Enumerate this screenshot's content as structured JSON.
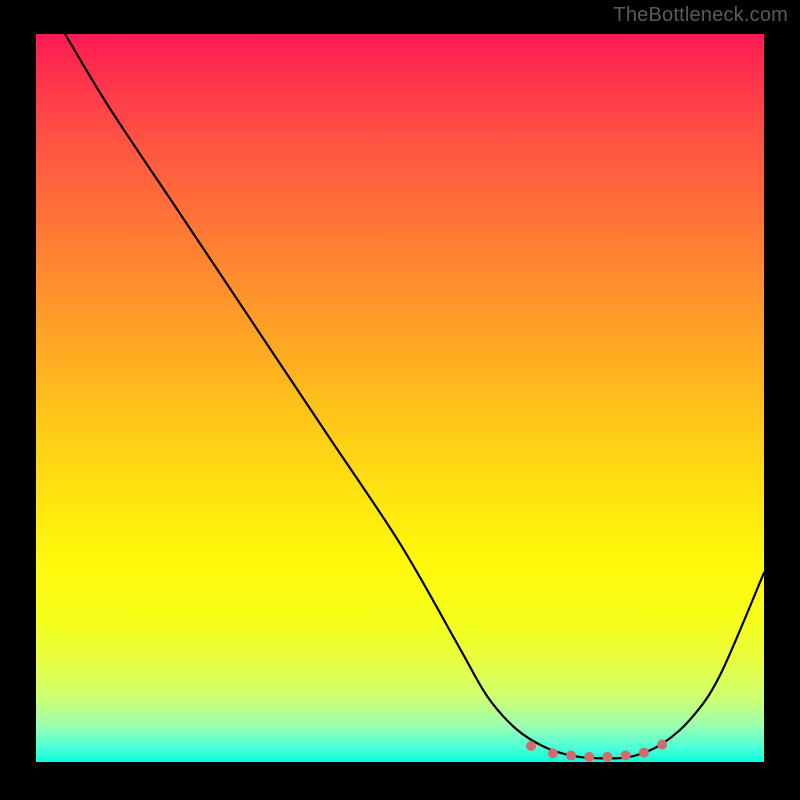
{
  "attribution": "TheBottleneck.com",
  "chart_data": {
    "type": "line",
    "title": "",
    "xlabel": "",
    "ylabel": "",
    "xlim": [
      0,
      100
    ],
    "ylim": [
      0,
      100
    ],
    "series": [
      {
        "name": "bottleneck-curve",
        "x": [
          4,
          10,
          20,
          30,
          40,
          50,
          58,
          62,
          66,
          70,
          74,
          78,
          82,
          86,
          90,
          94,
          100
        ],
        "y": [
          100,
          90,
          75,
          60,
          45,
          30,
          16,
          9,
          4.5,
          2,
          0.8,
          0.5,
          0.8,
          2.5,
          6,
          12,
          26
        ]
      }
    ],
    "markers": {
      "name": "bottleneck-dots",
      "x": [
        68,
        71,
        73.5,
        76,
        78.5,
        81,
        83.5,
        86
      ],
      "y": [
        2.2,
        1.2,
        0.9,
        0.7,
        0.7,
        0.9,
        1.3,
        2.4
      ],
      "color": "#d46a6a",
      "radius": 5
    },
    "gradient_stops": [
      {
        "pos": 0,
        "color": "#ff1a52"
      },
      {
        "pos": 50,
        "color": "#ffc018"
      },
      {
        "pos": 80,
        "color": "#fff80a"
      },
      {
        "pos": 100,
        "color": "#0affd8"
      }
    ]
  }
}
